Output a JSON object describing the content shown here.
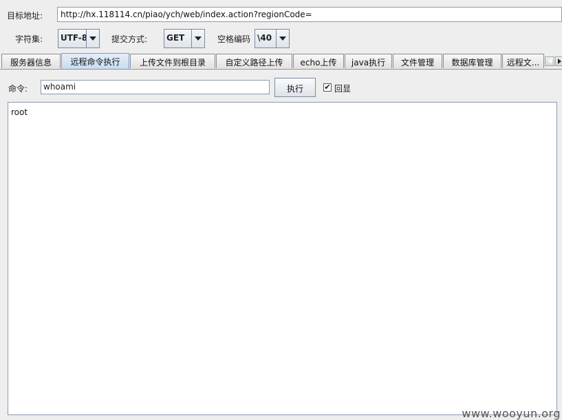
{
  "target": {
    "label": "目标地址:",
    "url": "http://hx.118114.cn/piao/ych/web/index.action?regionCode="
  },
  "options": {
    "charset_label": "字符集:",
    "charset_value": "UTF-8",
    "method_label": "提交方式:",
    "method_value": "GET",
    "space_label": "空格编码",
    "space_value": "\\40"
  },
  "tabs": [
    {
      "label": "服务器信息"
    },
    {
      "label": "远程命令执行",
      "active": true
    },
    {
      "label": "上传文件到根目录"
    },
    {
      "label": "自定义路径上传"
    },
    {
      "label": "echo上传"
    },
    {
      "label": "java执行"
    },
    {
      "label": "文件管理"
    },
    {
      "label": "数据库管理"
    },
    {
      "label": "远程文..."
    }
  ],
  "command": {
    "label": "命令:",
    "value": "whoami",
    "exec_label": "执行",
    "echo_label": "回显",
    "echo_checked": true,
    "echo_check_glyph": "✔"
  },
  "output": {
    "text": "root"
  },
  "watermark": "www.wooyun.org"
}
